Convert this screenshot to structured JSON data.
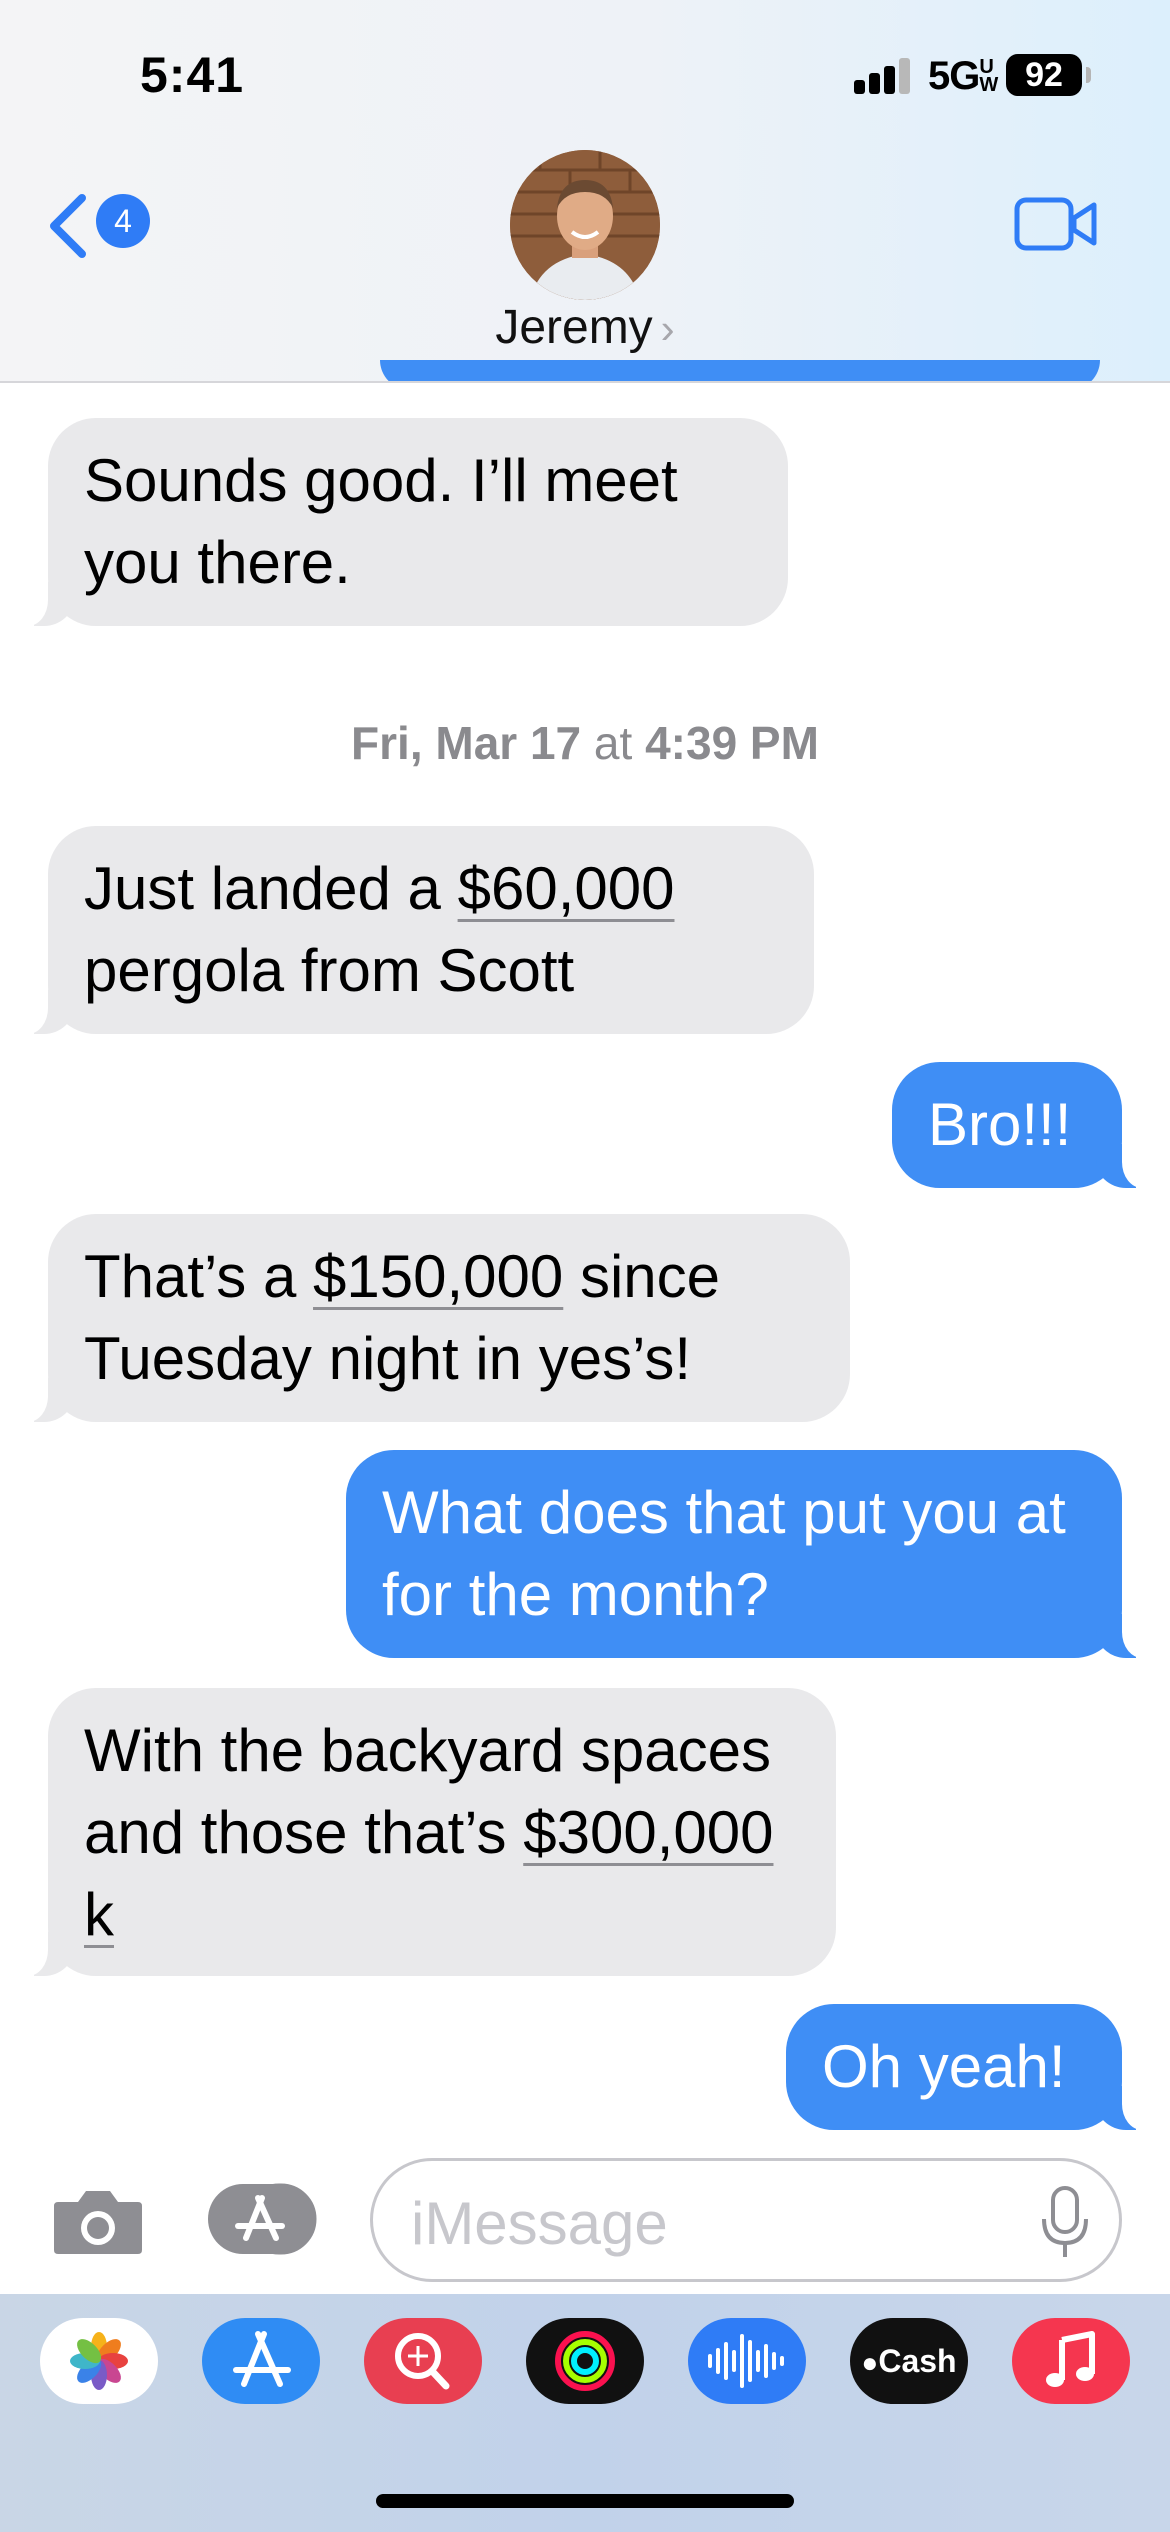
{
  "status_bar": {
    "time": "5:41",
    "network": "5G",
    "network_suffix": "UW",
    "battery": "92"
  },
  "header": {
    "back_badge": "4",
    "contact_name": "Jeremy",
    "contact_chevron": "›",
    "icons": [
      "back-chevron-icon",
      "avatar",
      "video-camera-icon"
    ]
  },
  "timestamp": {
    "day": "Fri, Mar 17",
    "at": "at",
    "time": "4:39 PM"
  },
  "messages": [
    {
      "from": "them",
      "parts": [
        "Sounds good. I’ll meet you there."
      ]
    },
    {
      "from": "them",
      "parts": [
        "Just landed a ",
        "$60,000",
        " pergola from Scott"
      ]
    },
    {
      "from": "me",
      "parts": [
        "Bro!!!"
      ]
    },
    {
      "from": "them",
      "parts": [
        "That’s a ",
        "$150,000",
        " since Tuesday night in yes’s!"
      ]
    },
    {
      "from": "me",
      "parts": [
        "What does that put you at for the month?"
      ]
    },
    {
      "from": "them",
      "parts": [
        "With the backyard spaces and those that’s ",
        "$300,000 k"
      ]
    },
    {
      "from": "me",
      "parts": [
        "Oh yeah!"
      ]
    }
  ],
  "composer": {
    "placeholder": "iMessage"
  },
  "app_tray": {
    "cash_label": "Cash",
    "apps": [
      "photos-icon",
      "app-store-icon",
      "search-images-icon",
      "fitness-icon",
      "audio-message-icon",
      "apple-cash-icon",
      "music-icon"
    ]
  },
  "colors": {
    "incoming": "#e9e9eb",
    "outgoing": "#3f8ef5",
    "accent": "#2f7cf6"
  }
}
